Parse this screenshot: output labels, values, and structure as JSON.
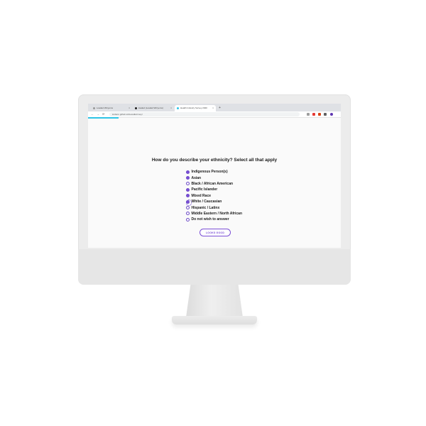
{
  "browser": {
    "tabs": [
      {
        "label": "Loaded Wizyems"
      },
      {
        "label": "loaded (Loaded Wizyems)"
      },
      {
        "label": "Health Industry Survey 2020"
      }
    ],
    "new_tab_label": "+",
    "tab_close_label": "×",
    "url": "lordann.github.io/lcessdiscrmey/",
    "nav": {
      "back": "←",
      "forward": "→",
      "reload": "⟳",
      "lock": "🔒"
    },
    "progress": 0.12,
    "extension_colors": [
      "#9e9e9e",
      "#e53935",
      "#d84315",
      "#616161",
      "#5e35b1"
    ]
  },
  "survey": {
    "question": "How do you describe your ethnicity? Select all that apply",
    "options": [
      {
        "label": "Indigenous Person(s)",
        "checked": true
      },
      {
        "label": "Asian",
        "checked": true
      },
      {
        "label": "Black / African American",
        "checked": false
      },
      {
        "label": "Pacific Islander",
        "checked": true
      },
      {
        "label": "Mixed Race",
        "checked": true
      },
      {
        "label": "White / Caucasian",
        "checked": true
      },
      {
        "label": "Hispanic / Latinx",
        "checked": false
      },
      {
        "label": "Middle Eastern / North African",
        "checked": false
      },
      {
        "label": "Do not wish to answer",
        "checked": false
      }
    ],
    "submit_label": "LOOKS GOOD"
  },
  "colors": {
    "accent": "#7b4fd6",
    "progress": "#2ec4e6"
  }
}
